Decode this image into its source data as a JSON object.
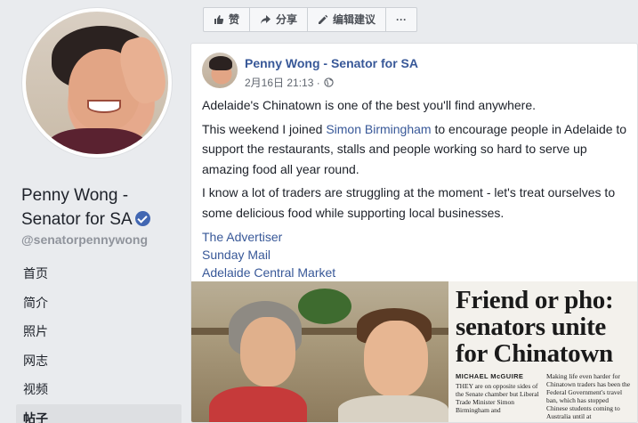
{
  "profile": {
    "name": "Penny Wong - Senator for SA",
    "handle": "@senatorpennywong"
  },
  "nav": {
    "items": [
      "首页",
      "简介",
      "照片",
      "网志",
      "视频",
      "帖子"
    ],
    "active_index": 5
  },
  "actions": {
    "like": "赞",
    "share": "分享",
    "suggest_edit": "编辑建议",
    "more": "···"
  },
  "post": {
    "author": "Penny Wong - Senator for SA",
    "timestamp": "2月16日 21:13 ·",
    "p1": "Adelaide's Chinatown is one of the best you'll find anywhere.",
    "p2_before": "This weekend I joined ",
    "p2_link": "Simon Birmingham",
    "p2_after": " to encourage people in Adelaide to support the restaurants, stalls and people working so hard to serve up amazing food all year round.",
    "p3": "I know a lot of traders are struggling at the moment - let's treat ourselves to some delicious food while supporting local businesses.",
    "links": [
      "The Advertiser",
      "Sunday Mail",
      "Adelaide Central Market"
    ]
  },
  "clipping": {
    "headline": "Friend or pho: senators unite for Chinatown",
    "byline": "MICHAEL McGUIRE",
    "col1": "THEY are on opposite sides of the Senate chamber but Liberal Trade Minister Simon Birmingham and",
    "col2": "Making life even harder for Chinatown traders has been the Federal Government's travel ban, which has stopped Chinese students coming to Australia until at"
  },
  "colors": {
    "link": "#385898",
    "verified": "#4267b2",
    "page_bg": "#e9ebee"
  }
}
